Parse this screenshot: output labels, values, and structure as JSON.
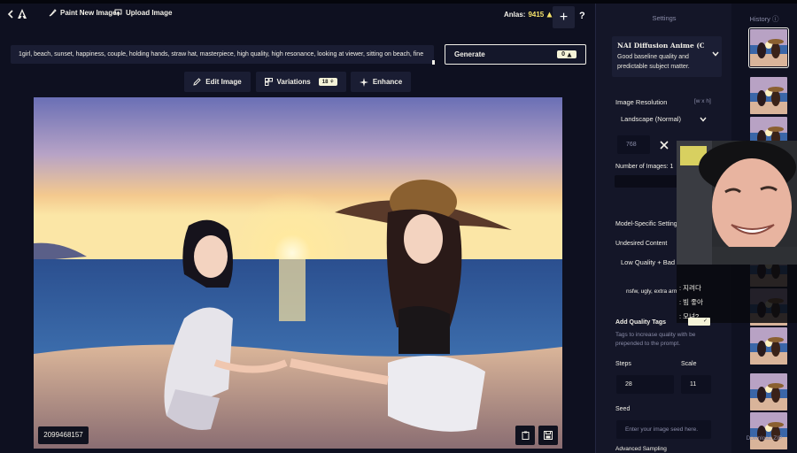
{
  "header": {
    "paint_label": "Paint New Image",
    "upload_label": "Upload Image",
    "anlas_label": "Anlas:",
    "anlas_value": "9415",
    "help_label": "?"
  },
  "prompt": {
    "text": "1girl, beach, sunset, happiness, couple, holding hands,  straw hat, masterpiece, high quality, high resonance, looking at viewer, sitting on beach, fine"
  },
  "generate": {
    "label": "Generate",
    "cost": "0"
  },
  "tools": {
    "edit_label": "Edit Image",
    "variations_label": "Variations",
    "variations_cost": "18",
    "enhance_label": "Enhance"
  },
  "image": {
    "seed": "2099468157"
  },
  "settings": {
    "title": "Settings",
    "model_name": "NAI Diffusion Anime (Curated)",
    "model_desc": "Good baseline quality and predictable subject matter.",
    "resolution_label": "Image Resolution",
    "resolution_unit": "[w x h]",
    "resolution_value": "Landscape (Normal)",
    "width_value": "768",
    "num_images_label": "Number of Images:",
    "num_images_value": "1",
    "model_specific_label": "Model-Specific Settings",
    "undesired_label": "Undesired Content",
    "undesired_preset": "Low Quality + Bad",
    "undesired_text": "nsfw, ugly, extra arms",
    "quality_tags_label": "Add Quality Tags",
    "quality_tags_desc": "Tags to increase quality with be prepended to the prompt.",
    "steps_label": "Steps",
    "steps_value": "28",
    "scale_label": "Scale",
    "scale_value": "11",
    "seed_label": "Seed",
    "seed_placeholder": "Enter your image seed here.",
    "advanced_label": "Advanced Sampling"
  },
  "history": {
    "title": "History",
    "download_label": "Download ZIP"
  },
  "overlay": {
    "chat": [
      ": 지려다",
      ": 빔 좋아",
      ": 모녀?"
    ]
  },
  "colors": {
    "background": "#0e1020",
    "panel": "#141628",
    "accent_yellow": "#f5e26b",
    "badge_bg": "#f5f3d8",
    "text": "#f2f0e8",
    "muted": "#8a8ca8"
  }
}
